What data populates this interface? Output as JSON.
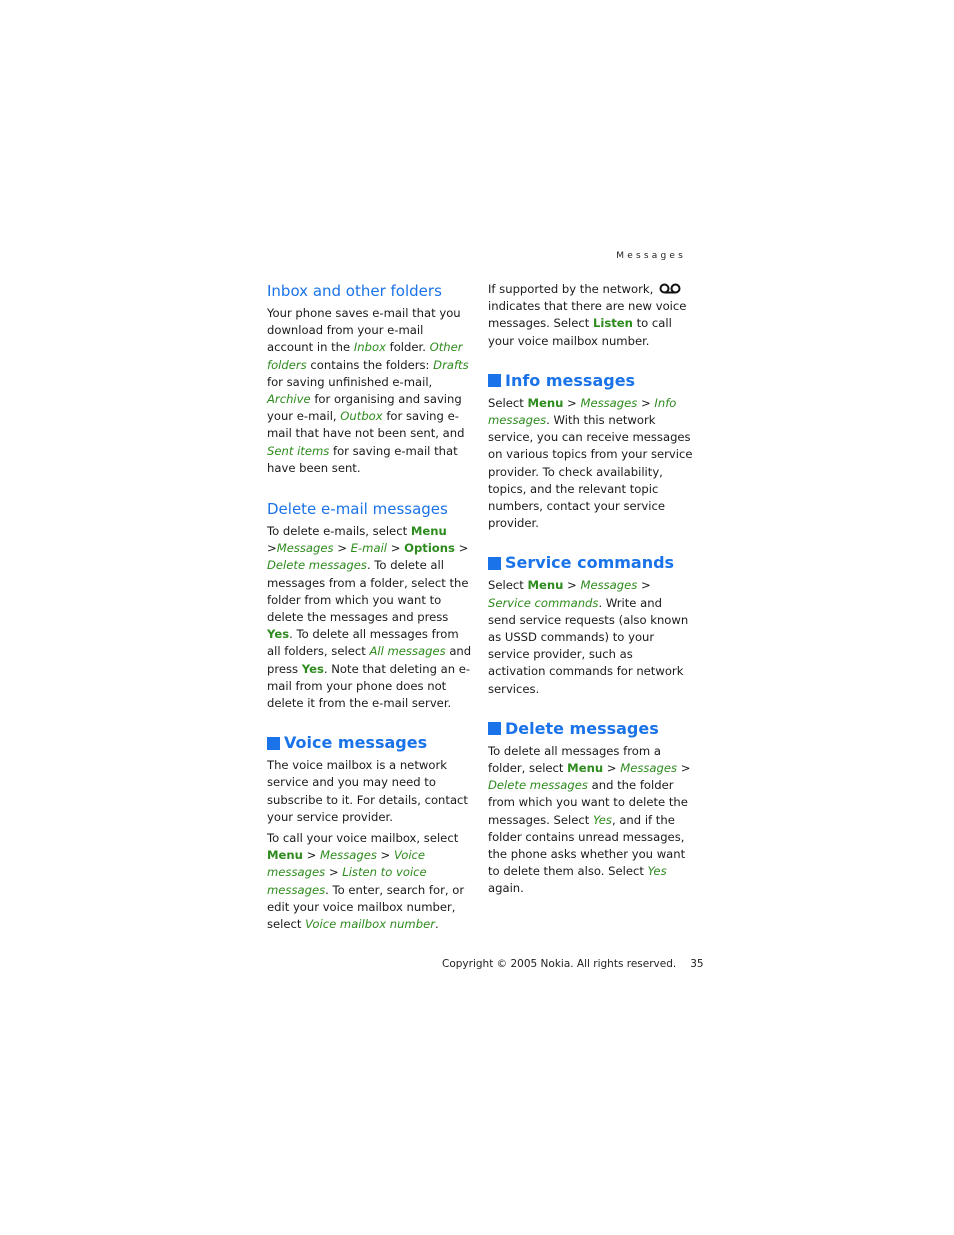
{
  "running_head": "Messages",
  "left": {
    "inbox": {
      "title": "Inbox and other folders",
      "p1": [
        "Your phone saves e-mail that you download from your e-mail account in the ",
        "Inbox",
        " folder. ",
        "Other folders",
        " contains the folders: ",
        "Drafts",
        " for saving unfinished e-mail, ",
        "Archive",
        " for organising and saving your e-mail, ",
        "Outbox",
        " for saving e-mail that have not been sent, and ",
        "Sent items",
        " for saving e-mail that have been sent."
      ]
    },
    "delete_email": {
      "title": "Delete e-mail messages",
      "p1": [
        "To delete e-mails, select ",
        "Menu",
        " >",
        "Messages",
        " > ",
        "E-mail",
        " > ",
        "Options",
        " > ",
        "Delete messages",
        ". To delete all messages from a folder, select the folder from which you want to delete the messages and press ",
        "Yes",
        ". To delete all messages from all folders, select ",
        "All messages",
        " and press ",
        "Yes",
        ". Note that deleting an e-mail from your phone does not delete it from the e-mail server."
      ]
    },
    "voice": {
      "title": "Voice messages",
      "p1": "The voice mailbox is a network service and you may need to subscribe to it. For details, contact your service provider.",
      "p2": [
        "To call your voice mailbox, select ",
        "Menu",
        " > ",
        "Messages",
        " > ",
        "Voice messages",
        " > ",
        "Listen to voice messages",
        ". To enter, search for, or edit your voice mailbox number, select ",
        "Voice mailbox number",
        "."
      ]
    }
  },
  "right": {
    "voice_cont": {
      "p1a": "If supported by the network, ",
      "icon": "voicemail-icon",
      "p1b": " indicates that there are new voice messages. Select ",
      "listen": "Listen",
      "p1c": " to call your voice mailbox number."
    },
    "info": {
      "title": "Info messages",
      "p1": [
        "Select ",
        "Menu",
        " > ",
        "Messages",
        " > ",
        "Info messages",
        ". With this network service, you can receive messages on various topics from your service provider. To check availability, topics, and the relevant topic numbers, contact your service provider."
      ]
    },
    "service": {
      "title": "Service commands",
      "p1": [
        "Select ",
        "Menu",
        " > ",
        "Messages",
        " > ",
        "Service commands",
        ". Write and send service requests (also known as USSD commands) to your service provider, such as activation commands for network services."
      ]
    },
    "delete": {
      "title": "Delete messages",
      "p1": [
        "To delete all messages from a folder, select ",
        "Menu",
        " > ",
        "Messages",
        " > ",
        "Delete messages",
        " and the folder from which you want to delete the messages. Select ",
        "Yes",
        ", and if the folder contains unread messages, the phone asks whether you want to delete them also. Select ",
        "Yes",
        " again."
      ]
    }
  },
  "footer": {
    "copyright": "Copyright © 2005 Nokia. All rights reserved.",
    "page_number": "35"
  },
  "colors": {
    "heading": "#1a73e8",
    "menu_term": "#2e8b1e"
  }
}
